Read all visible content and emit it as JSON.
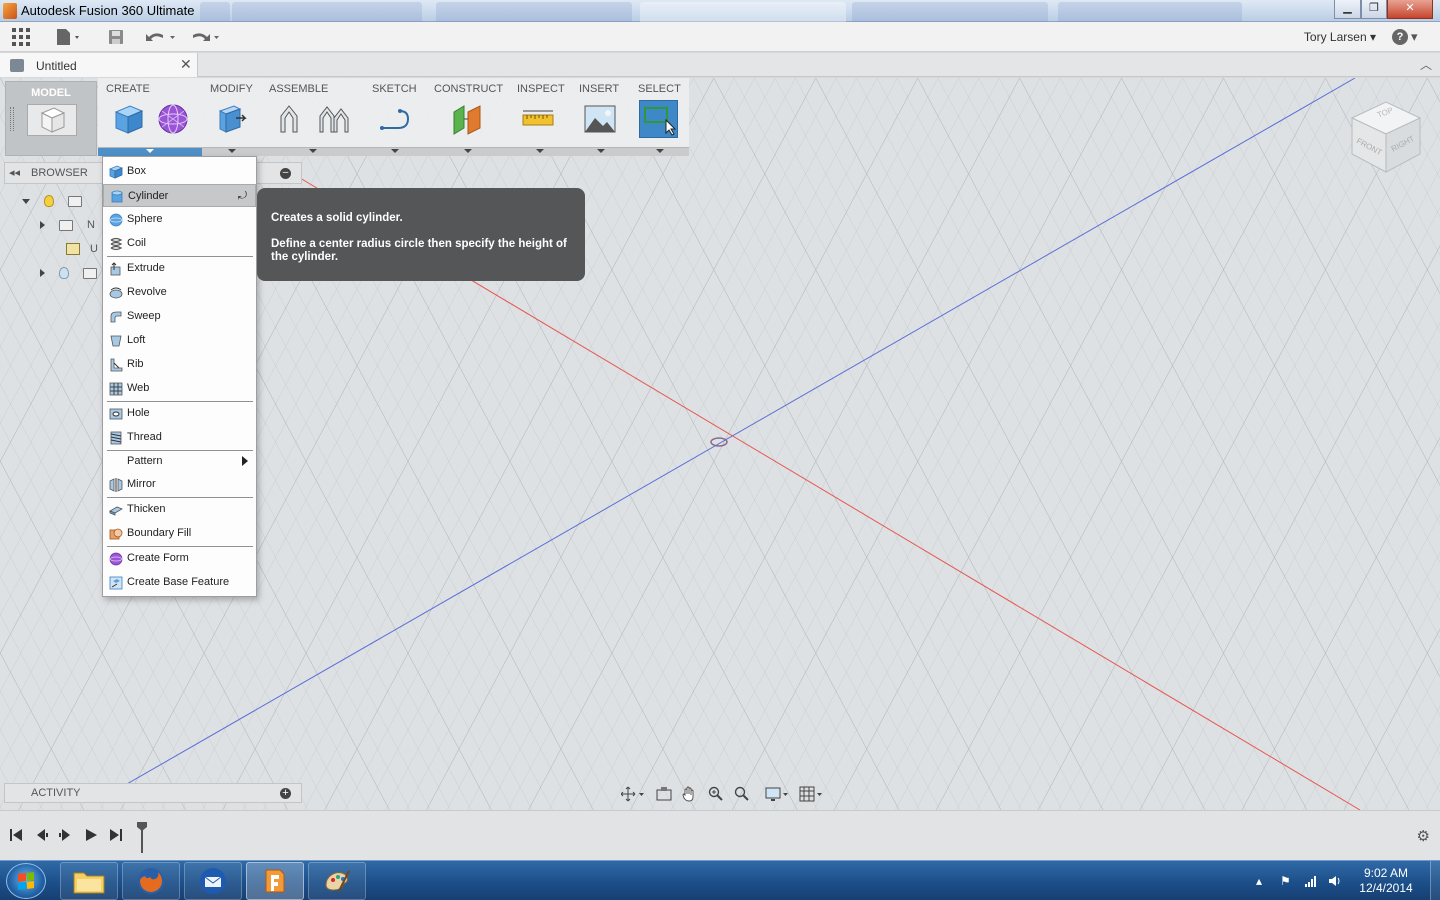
{
  "window": {
    "title": "Autodesk Fusion 360 Ultimate",
    "controls": {
      "minimize": "▁",
      "maximize": "❐",
      "close": "✕"
    }
  },
  "toolbar": {
    "user_name": "Tory Larsen",
    "help_label": "?"
  },
  "document": {
    "tab_title": "Untitled",
    "close_glyph": "✕"
  },
  "workspace": {
    "label": "MODEL"
  },
  "ribbon": {
    "groups": [
      {
        "label": "CREATE",
        "active": true
      },
      {
        "label": "MODIFY"
      },
      {
        "label": "ASSEMBLE"
      },
      {
        "label": "SKETCH"
      },
      {
        "label": "CONSTRUCT"
      },
      {
        "label": "INSPECT"
      },
      {
        "label": "INSERT"
      },
      {
        "label": "SELECT"
      }
    ]
  },
  "browser": {
    "label": "BROWSER",
    "collapse_glyph": "◂◂",
    "minus_glyph": "–",
    "tree_text_1": "N",
    "tree_text_2": "U"
  },
  "create_menu": {
    "items": [
      {
        "label": "Box",
        "icon": "box-icon"
      },
      {
        "label": "Cylinder",
        "icon": "cylinder-icon",
        "highlighted": true
      },
      {
        "label": "Sphere",
        "icon": "sphere-icon"
      },
      {
        "label": "Coil",
        "icon": "coil-icon"
      },
      {
        "label": "Extrude",
        "icon": "extrude-icon"
      },
      {
        "label": "Revolve",
        "icon": "revolve-icon"
      },
      {
        "label": "Sweep",
        "icon": "sweep-icon"
      },
      {
        "label": "Loft",
        "icon": "loft-icon"
      },
      {
        "label": "Rib",
        "icon": "rib-icon"
      },
      {
        "label": "Web",
        "icon": "web-icon"
      },
      {
        "label": "Hole",
        "icon": "hole-icon"
      },
      {
        "label": "Thread",
        "icon": "thread-icon"
      },
      {
        "label": "Pattern",
        "icon": "",
        "submenu": true
      },
      {
        "label": "Mirror",
        "icon": "mirror-icon"
      },
      {
        "label": "Thicken",
        "icon": "thicken-icon"
      },
      {
        "label": "Boundary Fill",
        "icon": "boundary-fill-icon"
      },
      {
        "label": "Create Form",
        "icon": "create-form-icon"
      },
      {
        "label": "Create Base Feature",
        "icon": "base-feature-icon"
      }
    ]
  },
  "tooltip": {
    "title": "Creates a solid cylinder.",
    "body": "Define a center radius circle then specify the height of the cylinder."
  },
  "viewcube": {
    "top": "TOP",
    "front": "FRONT",
    "right": "RIGHT"
  },
  "activity": {
    "label": "ACTIVITY",
    "plus_glyph": "+"
  },
  "taskbar": {
    "time": "9:02 AM",
    "date": "12/4/2014"
  },
  "colors": {
    "x_axis": "#e8564e",
    "z_axis": "#5a6fd6",
    "ribbon_active": "#4f8fc7",
    "tooltip_bg": "#555657"
  }
}
